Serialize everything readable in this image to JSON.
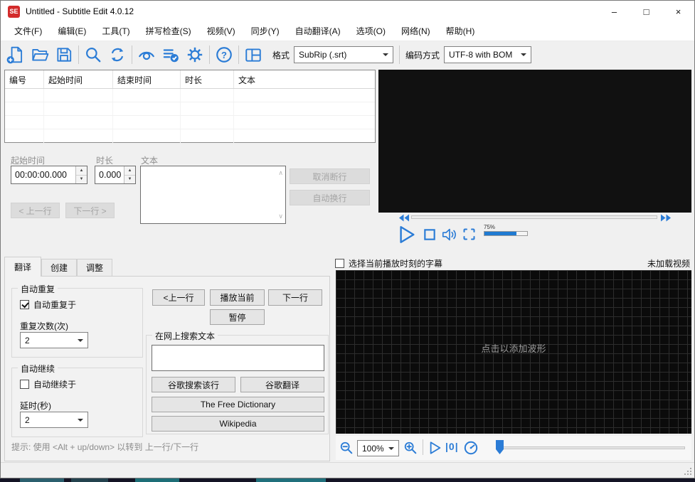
{
  "window": {
    "title": "Untitled - Subtitle Edit 4.0.12",
    "app_icon": "SE",
    "controls": {
      "minimize": "–",
      "maximize": "□",
      "close": "×"
    }
  },
  "menu": {
    "items": [
      "文件(F)",
      "编辑(E)",
      "工具(T)",
      "拼写检查(S)",
      "视频(V)",
      "同步(Y)",
      "自动翻译(A)",
      "选项(O)",
      "网络(N)",
      "帮助(H)"
    ]
  },
  "toolbar": {
    "icons": [
      "new-file",
      "open-file",
      "save-file",
      "find",
      "replace",
      "visual-sync",
      "spell-check",
      "settings",
      "help",
      "layout"
    ],
    "format_label": "格式",
    "format_value": "SubRip (.srt)",
    "encoding_label": "编码方式",
    "encoding_value": "UTF-8 with BOM"
  },
  "subtitle_list": {
    "columns": [
      "编号",
      "起始时间",
      "结束时间",
      "时长",
      "文本"
    ]
  },
  "editor": {
    "start_time_label": "起始时间",
    "start_time_value": "00:00:00.000",
    "duration_label": "时长",
    "duration_value": "0.000",
    "text_label": "文本",
    "unbreak_button": "取消断行",
    "auto_break_button": "自动换行",
    "prev_line_button": "< 上一行",
    "next_line_button": "下一行 >"
  },
  "video_player": {
    "icons": [
      "seek-back",
      "seek-forward",
      "play",
      "stop",
      "speaker",
      "fullscreen"
    ],
    "volume_label": "75%"
  },
  "bottom_tabs": {
    "tabs": [
      "翻译",
      "创建",
      "调整"
    ],
    "active_tab": "翻译"
  },
  "translate": {
    "auto_repeat_group": "自动重复",
    "auto_repeat_checkbox": "自动重复于",
    "repeat_count_label": "重复次数(次)",
    "repeat_count_value": "2",
    "auto_continue_group": "自动继续",
    "auto_continue_checkbox": "自动继续于",
    "delay_label": "延时(秒)",
    "delay_value": "2",
    "prev_button": "<上一行",
    "play_current_button": "播放当前",
    "next_button": "下一行",
    "pause_button": "暂停",
    "web_search_group": "在网上搜索文本",
    "google_search_button": "谷歌搜索该行",
    "google_translate_button": "谷歌翻译",
    "free_dictionary_button": "The Free Dictionary",
    "wikipedia_button": "Wikipedia",
    "hint": "提示: 使用 <Alt + up/down> 以转到 上一行/下一行"
  },
  "waveform": {
    "select_current_checkbox": "选择当前播放时刻的字幕",
    "video_status": "未加载视频",
    "placeholder": "点击以添加波形",
    "zoom_value": "100%",
    "one_sec_icon": "|0|",
    "icons": [
      "zoom-out",
      "zoom-in",
      "play",
      "one-second",
      "speed-gauge"
    ]
  },
  "colors": {
    "icon_blue": "#2b7cd6",
    "volume_fill": "#1f7ad1",
    "app_icon_red": "#d32b2b"
  }
}
